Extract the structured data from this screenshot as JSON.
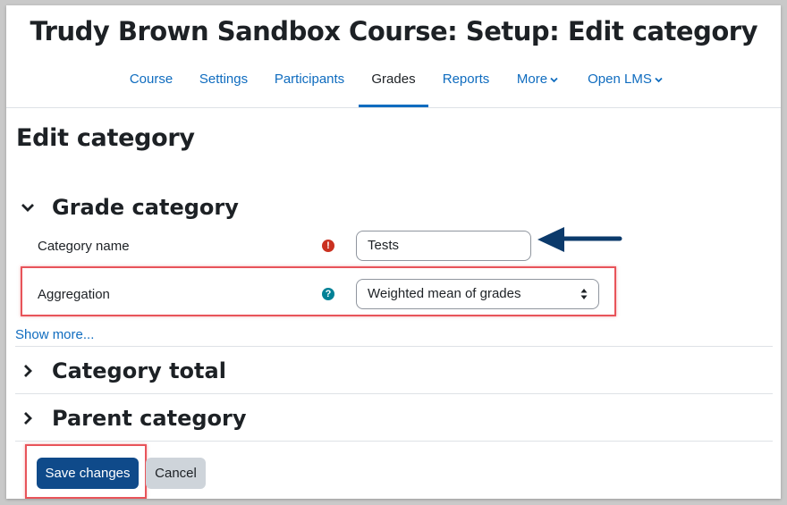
{
  "header": {
    "course_title": "Trudy Brown Sandbox Course: Setup: Edit category"
  },
  "nav": {
    "items": [
      {
        "label": "Course"
      },
      {
        "label": "Settings"
      },
      {
        "label": "Participants"
      },
      {
        "label": "Grades",
        "active": true
      },
      {
        "label": "Reports"
      },
      {
        "label": "More",
        "dropdown": true
      },
      {
        "label": "Open LMS",
        "dropdown": true
      }
    ]
  },
  "page": {
    "heading": "Edit category"
  },
  "grade_category": {
    "title": "Grade category",
    "category_name_label": "Category name",
    "category_name_value": "Tests",
    "required_icon": "exclamation-circle-icon",
    "aggregation_label": "Aggregation",
    "aggregation_value": "Weighted mean of grades",
    "help_icon": "question-circle-icon",
    "show_more": "Show more..."
  },
  "sections": [
    {
      "title": "Category total",
      "expanded": false
    },
    {
      "title": "Parent category",
      "expanded": false
    }
  ],
  "buttons": {
    "save": "Save changes",
    "cancel": "Cancel"
  },
  "colors": {
    "link": "#0f6cbf",
    "primary_button": "#0f4a8a",
    "highlight": "#e8545a",
    "annotation_arrow": "#0b3a6b",
    "required": "#ca3120",
    "help": "#008196"
  }
}
